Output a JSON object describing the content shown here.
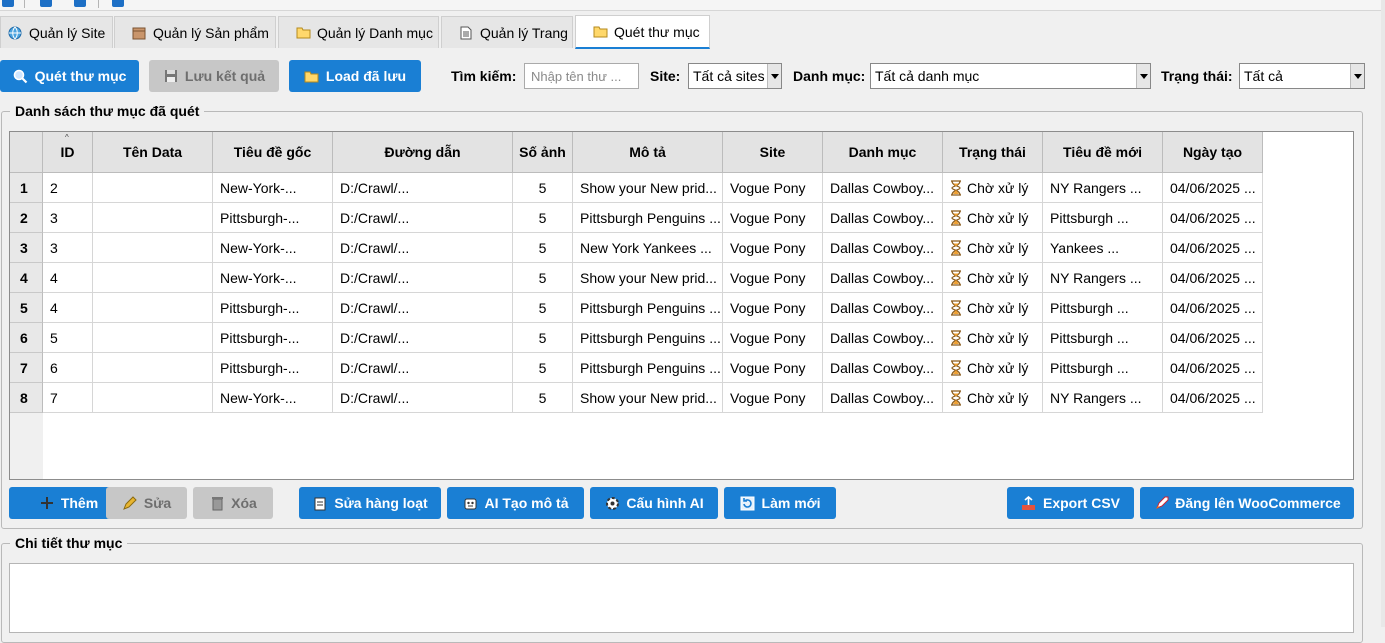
{
  "tabs": [
    {
      "label": "Quản lý Site",
      "icon": "globe-icon"
    },
    {
      "label": "Quản lý Sản phẩm",
      "icon": "box-icon"
    },
    {
      "label": "Quản lý Danh mục",
      "icon": "folder-icon"
    },
    {
      "label": "Quản lý Trang",
      "icon": "page-icon"
    },
    {
      "label": "Quét thư mục",
      "icon": "folder-icon"
    }
  ],
  "active_tab": 4,
  "toolbar": {
    "scan_label": "Quét thư mục",
    "save_label": "Lưu kết quả",
    "load_label": "Load đã lưu",
    "search_label": "Tìm kiếm:",
    "search_placeholder": "Nhập tên thư ...",
    "site_label": "Site:",
    "site_value": "Tất cả sites",
    "category_label": "Danh mục:",
    "category_value": "Tất cả danh mục",
    "status_label": "Trạng thái:",
    "status_value": "Tất cả"
  },
  "list_group_title": "Danh sách thư mục đã quét",
  "columns": [
    "ID",
    "Tên Data",
    "Tiêu đề gốc",
    "Đường dẫn",
    "Số ảnh",
    "Mô tả",
    "Site",
    "Danh mục",
    "Trạng thái",
    "Tiêu đề mới",
    "Ngày tạo"
  ],
  "rows": [
    {
      "n": "1",
      "cells": [
        "2",
        "",
        "New-York-...",
        "D:/Crawl/...",
        "5",
        "Show your New prid...",
        "Vogue Pony",
        "Dallas Cowboy...",
        "Chờ xử lý",
        "NY Rangers ...",
        "04/06/2025 ..."
      ]
    },
    {
      "n": "2",
      "cells": [
        "3",
        "",
        "Pittsburgh-...",
        "D:/Crawl/...",
        "5",
        "Pittsburgh Penguins ...",
        "Vogue Pony",
        "Dallas Cowboy...",
        "Chờ xử lý",
        "Pittsburgh ...",
        "04/06/2025 ..."
      ]
    },
    {
      "n": "3",
      "cells": [
        "3",
        "",
        "New-York-...",
        "D:/Crawl/...",
        "5",
        "New York Yankees ...",
        "Vogue Pony",
        "Dallas Cowboy...",
        "Chờ xử lý",
        "Yankees ...",
        "04/06/2025 ..."
      ]
    },
    {
      "n": "4",
      "cells": [
        "4",
        "",
        "New-York-...",
        "D:/Crawl/...",
        "5",
        "Show your New prid...",
        "Vogue Pony",
        "Dallas Cowboy...",
        "Chờ xử lý",
        "NY Rangers ...",
        "04/06/2025 ..."
      ]
    },
    {
      "n": "5",
      "cells": [
        "4",
        "",
        "Pittsburgh-...",
        "D:/Crawl/...",
        "5",
        "Pittsburgh Penguins ...",
        "Vogue Pony",
        "Dallas Cowboy...",
        "Chờ xử lý",
        "Pittsburgh ...",
        "04/06/2025 ..."
      ]
    },
    {
      "n": "6",
      "cells": [
        "5",
        "",
        "Pittsburgh-...",
        "D:/Crawl/...",
        "5",
        "Pittsburgh Penguins ...",
        "Vogue Pony",
        "Dallas Cowboy...",
        "Chờ xử lý",
        "Pittsburgh ...",
        "04/06/2025 ..."
      ]
    },
    {
      "n": "7",
      "cells": [
        "6",
        "",
        "Pittsburgh-...",
        "D:/Crawl/...",
        "5",
        "Pittsburgh Penguins ...",
        "Vogue Pony",
        "Dallas Cowboy...",
        "Chờ xử lý",
        "Pittsburgh ...",
        "04/06/2025 ..."
      ]
    },
    {
      "n": "8",
      "cells": [
        "7",
        "",
        "New-York-...",
        "D:/Crawl/...",
        "5",
        "Show your New prid...",
        "Vogue Pony",
        "Dallas Cowboy...",
        "Chờ xử lý",
        "NY Rangers ...",
        "04/06/2025 ..."
      ]
    }
  ],
  "actions": {
    "add_label": "Thêm",
    "edit_label": "Sửa",
    "delete_label": "Xóa",
    "bulk_edit_label": "Sửa hàng loạt",
    "ai_desc_label": "AI Tạo mô tả",
    "ai_config_label": "Cấu hình AI",
    "refresh_label": "Làm mới",
    "export_label": "Export CSV",
    "publish_label": "Đăng lên WooCommerce"
  },
  "detail_group_title": "Chi tiết thư mục",
  "colors": {
    "accent": "#1a7fd4",
    "disabled": "#c7c7c7",
    "background": "#f0f0f0"
  }
}
